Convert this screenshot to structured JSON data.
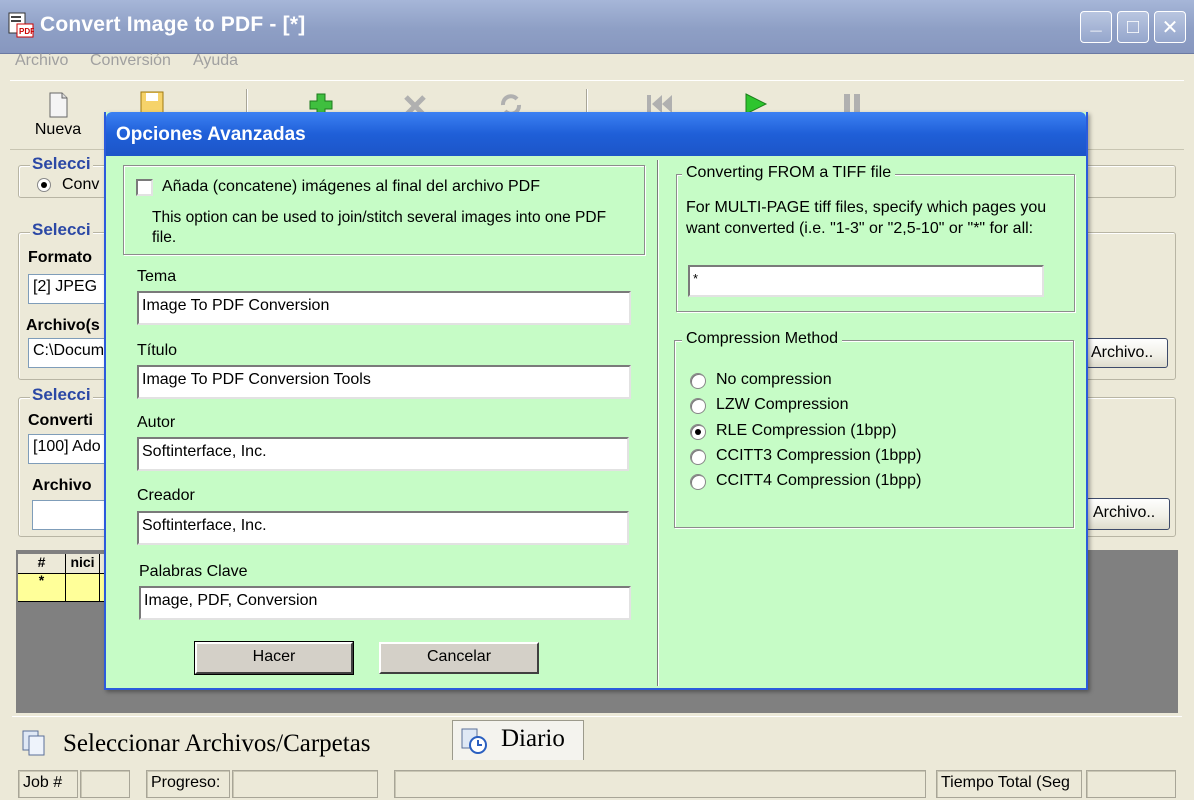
{
  "window": {
    "title": "Convert Image to PDF - [*]",
    "minimize": "_",
    "maximize": "□",
    "close": "✕"
  },
  "menu": [
    "Archivo",
    "Conversión",
    "Ayuda"
  ],
  "toolbar": {
    "new_label": "Nueva",
    "icons": [
      "new-document-icon",
      "save-icon",
      "add-icon",
      "delete-icon",
      "refresh-icon",
      "first-icon",
      "play-icon",
      "pause-icon"
    ]
  },
  "background": {
    "group1_title": "Selecci",
    "group1_radio": "Conv",
    "group2_title": "Selecci",
    "formato_label": "Formato",
    "formato_value": "[2] JPEG",
    "archivos_label": "Archivo(s",
    "archivos_value": "C:\\Docum",
    "archivo_button": "Archivo..",
    "group3_title": "Selecci",
    "converti_label": "Converti",
    "converti_value": "[100] Ado",
    "archivo_out_label": "Archivo",
    "archivo_out_value": "",
    "archivo_button2": "Archivo..",
    "grid_headers": [
      "#",
      "nici"
    ],
    "grid_new_row": "*"
  },
  "tabs": [
    {
      "label": "Seleccionar Archivos/Carpetas",
      "icon": "files-icon"
    },
    {
      "label": "Diario",
      "icon": "clock-icon"
    }
  ],
  "statusbar": {
    "job": "Job #",
    "progreso": "Progreso:",
    "tiempo": "Tiempo Total (Seg"
  },
  "dialog": {
    "title": "Opciones Avanzadas",
    "concat_label": "Añada (concatene) imágenes al final del archivo PDF",
    "concat_help": "This option can be used to join/stitch several images into one PDF file.",
    "concat_checked": false,
    "fields": [
      {
        "label": "Tema",
        "value": "Image To PDF Conversion"
      },
      {
        "label": "Título",
        "value": "Image To PDF Conversion Tools"
      },
      {
        "label": "Autor",
        "value": "Softinterface, Inc."
      },
      {
        "label": "Creador",
        "value": "Softinterface, Inc."
      },
      {
        "label": "Palabras Clave",
        "value": "Image, PDF, Conversion"
      }
    ],
    "ok_button": "Hacer",
    "cancel_button": "Cancelar",
    "tiff_group": {
      "title": "Converting FROM a TIFF file",
      "help": "For MULTI-PAGE tiff files, specify which pages you want converted (i.e. \"1-3\" or \"2,5-10\" or \"*\" for all:",
      "value": "*"
    },
    "compression": {
      "title": "Compression Method",
      "options": [
        "No compression",
        "LZW Compression",
        "RLE Compression (1bpp)",
        "CCITT3 Compression (1bpp)",
        "CCITT4 Compression (1bpp)"
      ],
      "selected": "RLE Compression (1bpp)"
    }
  }
}
